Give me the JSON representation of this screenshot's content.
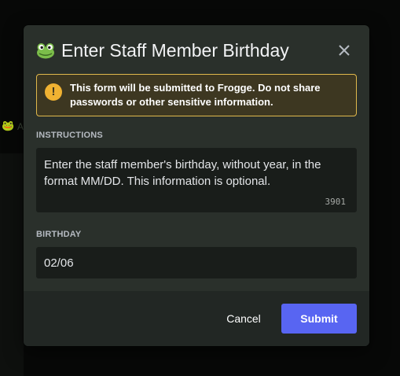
{
  "modal": {
    "title": "Enter Staff Member Birthday",
    "title_icon": "frog-icon",
    "close_icon": "close-icon"
  },
  "warning": {
    "icon": "exclamation-icon",
    "prefix": "This form will be submitted to ",
    "app_name": "Frogge",
    "suffix": ". Do not share passwords or other sensitive information."
  },
  "fields": {
    "instructions": {
      "label": "INSTRUCTIONS",
      "text": "Enter the staff member's birthday, without year, in the format MM/DD. This information is optional.",
      "char_count": "3901"
    },
    "birthday": {
      "label": "BIRTHDAY",
      "value": "02/06"
    }
  },
  "footer": {
    "cancel_label": "Cancel",
    "submit_label": "Submit"
  },
  "colors": {
    "accent": "#5865f2",
    "warning_border": "#e0b84c",
    "warning_icon": "#f0b232",
    "modal_bg": "#2a302b"
  }
}
